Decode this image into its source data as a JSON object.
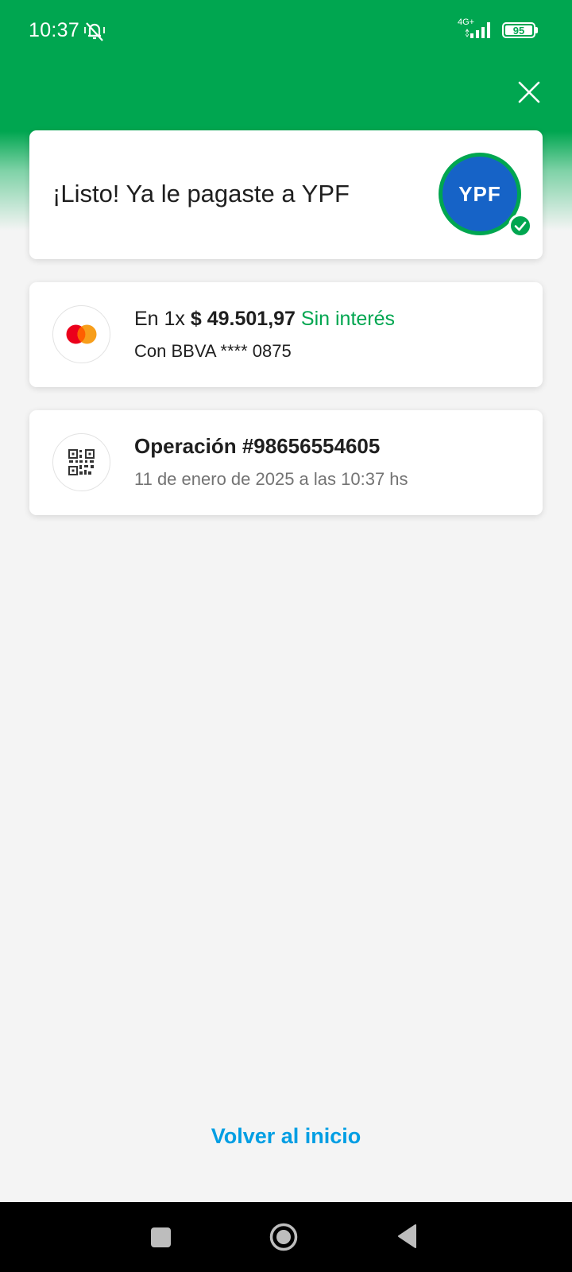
{
  "status_bar": {
    "time": "10:37",
    "mute_icon": "mute-icon",
    "network": "4G+",
    "battery": "95"
  },
  "header": {
    "close_icon": "close-icon",
    "colors": {
      "brand_green": "#00a650",
      "link_blue": "#009ee3"
    }
  },
  "success_card": {
    "title": "¡Listo! Ya le pagaste a YPF",
    "merchant_logo_text": "YPF",
    "badge_icon": "check-icon"
  },
  "payment_card": {
    "icon": "mastercard-icon",
    "installments": "En 1x",
    "amount": "$ 49.501,97",
    "interest": "Sin interés",
    "card_info": "Con BBVA **** 0875"
  },
  "operation_card": {
    "icon": "qr-code-icon",
    "title": "Operación #98656554605",
    "datetime": "11 de enero de 2025 a las 10:37 hs"
  },
  "footer": {
    "home_link": "Volver al inicio"
  },
  "nav_bar": {
    "recents_icon": "square-icon",
    "home_icon": "circle-icon",
    "back_icon": "triangle-back-icon"
  }
}
